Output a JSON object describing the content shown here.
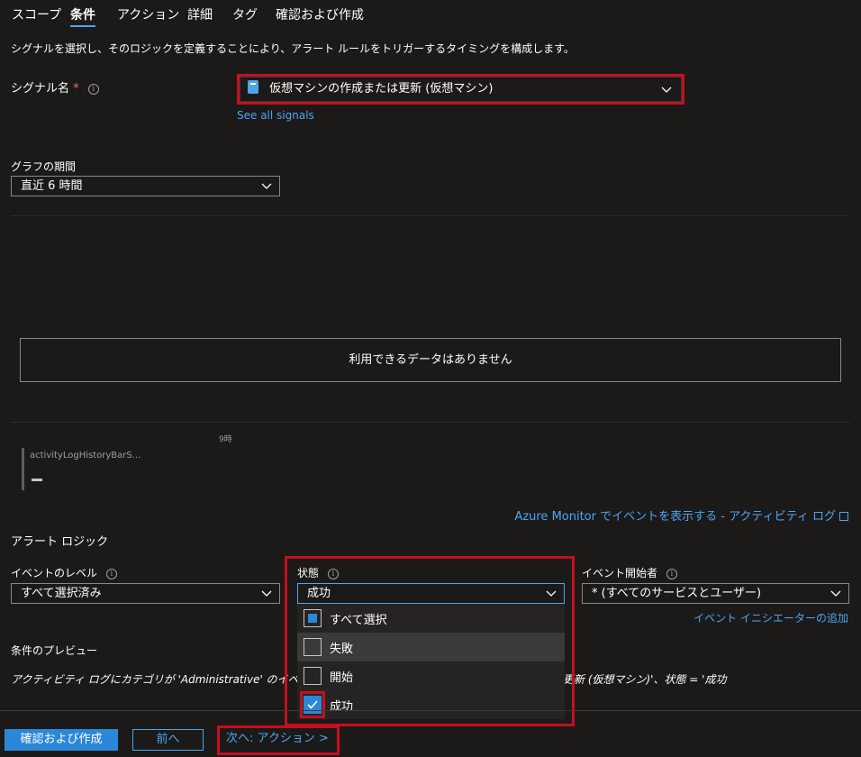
{
  "tabs": [
    {
      "label": "スコープ"
    },
    {
      "label": "条件"
    },
    {
      "label": "アクション"
    },
    {
      "label": "詳細"
    },
    {
      "label": "タグ"
    },
    {
      "label": "確認および作成"
    }
  ],
  "active_tab": "条件",
  "description": "シグナルを選択し、そのロジックを定義することにより、アラート ルールをトリガーするタイミングを構成します。",
  "signal": {
    "label": "シグナル名",
    "required_mark": "*",
    "value": "仮想マシンの作成または更新 (仮想マシン)",
    "see_all_link": "See all signals"
  },
  "graph_period": {
    "label": "グラフの期間",
    "value": "直近 6 時間"
  },
  "chart": {
    "no_data": "利用できるデータはありません",
    "x_tick": "9時",
    "legend_label": "activityLogHistoryBarS...",
    "legend_value": "--"
  },
  "view_events_link": "Azure Monitor でイベントを表示する - アクティビティ ログ",
  "alert_logic": {
    "title": "アラート ロジック",
    "event_level": {
      "label": "イベントのレベル",
      "value": "すべて選択済み"
    },
    "status": {
      "label": "状態",
      "value": "成功",
      "options": [
        {
          "label": "すべて選択",
          "state": "partial"
        },
        {
          "label": "失敗",
          "state": "unchecked"
        },
        {
          "label": "開始",
          "state": "unchecked"
        },
        {
          "label": "成功",
          "state": "checked"
        }
      ]
    },
    "initiator": {
      "label": "イベント開始者",
      "value": "* (すべてのサービスとユーザー)"
    },
    "add_initiator_link": "イベント イニシエーターの追加"
  },
  "preview": {
    "title": "条件のプレビュー",
    "text_left": "アクティビティ ログにカテゴリが 'Administrative' のイベントが含",
    "text_right": "更新 (仮想マシン)'、状態 = '成功"
  },
  "footer": {
    "review_create": "確認および作成",
    "previous": "前へ",
    "next": "次へ: アクション >"
  },
  "colors": {
    "accent": "#4ea4f5",
    "highlight_box": "#c50f1f",
    "checkbox_fill": "#2b88d8"
  }
}
